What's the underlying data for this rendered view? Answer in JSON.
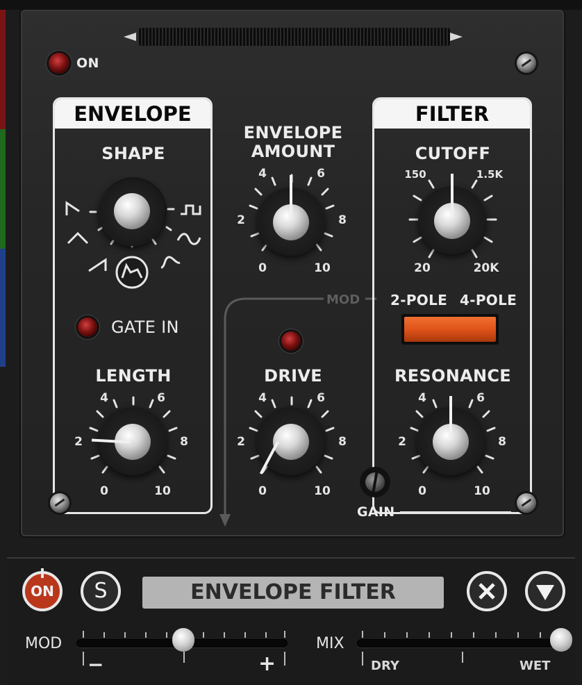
{
  "power": {
    "label": "ON"
  },
  "envelope": {
    "title": "ENVELOPE",
    "shape_label": "SHAPE",
    "gate_label": "GATE IN",
    "length_label": "LENGTH",
    "length_ticks": [
      "0",
      "2",
      "4",
      "6",
      "8",
      "10"
    ]
  },
  "center": {
    "env_amount_label_1": "ENVELOPE",
    "env_amount_label_2": "AMOUNT",
    "env_ticks": [
      "0",
      "2",
      "4",
      "6",
      "8",
      "10"
    ],
    "mod_label": "MOD",
    "drive_label": "DRIVE",
    "drive_ticks": [
      "0",
      "2",
      "4",
      "6",
      "8",
      "10"
    ]
  },
  "filter": {
    "title": "FILTER",
    "cutoff_label": "CUTOFF",
    "cutoff_ticks": [
      "20",
      "150",
      "1.5K",
      "20K"
    ],
    "pole_2": "2-POLE",
    "pole_4": "4-POLE",
    "resonance_label": "RESONANCE",
    "res_ticks": [
      "0",
      "2",
      "4",
      "6",
      "8",
      "10"
    ],
    "gain_label": "GAIN"
  },
  "bottom": {
    "on_label": "ON",
    "solo_label": "S",
    "preset_name": "ENVELOPE FILTER",
    "close_icon": "close-icon",
    "menu_icon": "triangle-down-icon",
    "mod_label": "MOD",
    "mod_minus": "−",
    "mod_plus": "+",
    "mix_label": "MIX",
    "mix_dry": "DRY",
    "mix_wet": "WET",
    "mod_value": 0.5,
    "mix_value": 1.0
  },
  "colors": {
    "accent_orange": "#e0531a",
    "led_red": "#7a1010",
    "on_button": "#b9381c"
  }
}
